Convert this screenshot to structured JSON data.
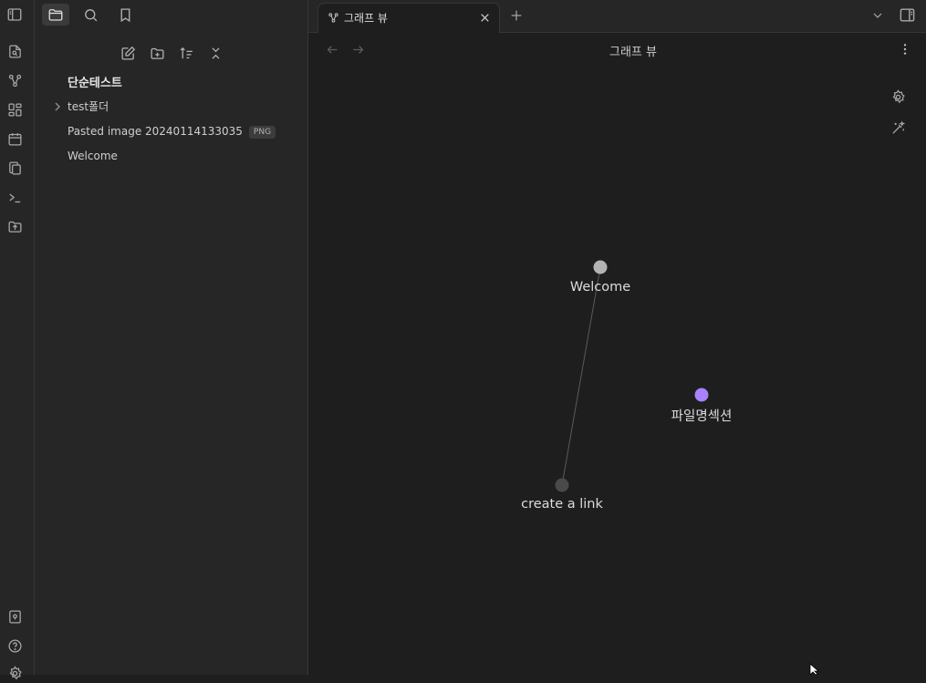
{
  "ribbon": {
    "top_icons": [
      "file-search-icon",
      "graph-icon",
      "canvas-icon",
      "calendar-icon",
      "copy-icon",
      "terminal-icon",
      "folder-upload-icon"
    ],
    "bottom_icons": [
      "vault-switch-icon",
      "help-icon",
      "settings-icon"
    ]
  },
  "sidebar": {
    "top_tabs": [
      {
        "name": "files",
        "icon": "folder-icon",
        "active": true
      },
      {
        "name": "search",
        "icon": "search-icon",
        "active": false
      },
      {
        "name": "bookmarks",
        "icon": "bookmark-icon",
        "active": false
      }
    ],
    "vault_name": "단순테스트",
    "tree": [
      {
        "label": "test폴더",
        "type": "folder",
        "collapsed": true
      },
      {
        "label": "Pasted image 20240114133035",
        "type": "file",
        "badge": "PNG"
      },
      {
        "label": "Welcome",
        "type": "file"
      }
    ]
  },
  "tabs": [
    {
      "title": "그래프 뷰",
      "icon": "graph-icon",
      "active": true
    }
  ],
  "view": {
    "title": "그래프 뷰"
  },
  "graph": {
    "nodes": [
      {
        "id": "welcome",
        "label": "Welcome",
        "color": "#b3b3b3"
      },
      {
        "id": "filename",
        "label": "파일명섹션",
        "color": "#a882ff"
      },
      {
        "id": "link",
        "label": "create a link",
        "color": "#4a4a4a"
      }
    ],
    "edges": [
      {
        "from": "welcome",
        "to": "link"
      }
    ]
  },
  "colors": {
    "accent": "#a882ff",
    "background": "#1e1e1e",
    "sidebar": "#262626"
  }
}
